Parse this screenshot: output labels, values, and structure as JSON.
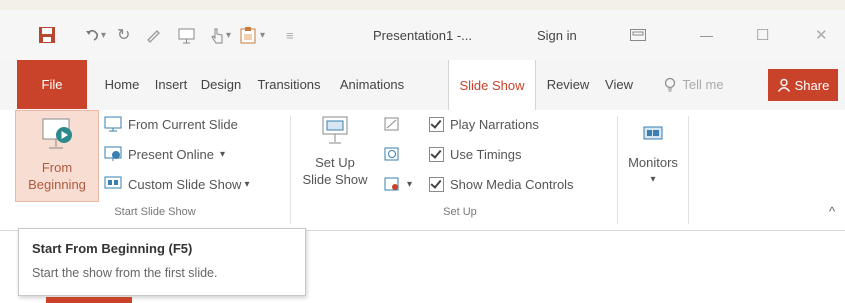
{
  "titlebar": {
    "doc_title": "Presentation1 -...",
    "sign_in": "Sign in",
    "min_glyph": "—",
    "max_glyph": "☐",
    "close_glyph": "✕",
    "undo_dropdown": "▾",
    "redo_glyph": "↻",
    "qat_dropdown": "▾",
    "qat_more": "▾"
  },
  "tabs": {
    "file": "File",
    "home": "Home",
    "insert": "Insert",
    "design": "Design",
    "transitions": "Transitions",
    "animations": "Animations",
    "slideshow": "Slide Show",
    "review": "Review",
    "view": "View",
    "tellme": "Tell me",
    "share": "Share"
  },
  "ribbon": {
    "start": {
      "from_beginning_line1": "From",
      "from_beginning_line2": "Beginning",
      "from_current": "From Current Slide",
      "present_online": "Present Online",
      "present_online_arrow": "▾",
      "custom_show": "Custom Slide Show",
      "custom_show_arrow": "▾",
      "group_label": "Start Slide Show"
    },
    "setup": {
      "setup_line1": "Set Up",
      "setup_line2": "Slide Show",
      "play_narrations": "Play Narrations",
      "use_timings": "Use Timings",
      "show_media_controls": "Show Media Controls",
      "small_dropdown": "▾",
      "group_label": "Set Up"
    },
    "monitors": {
      "label": "Monitors",
      "arrow": "▾"
    },
    "collapse_glyph": "^"
  },
  "tooltip": {
    "title": "Start From Beginning (F5)",
    "description": "Start the show from the first slide."
  },
  "colors": {
    "accent": "#c9432a",
    "ribbon_bg": "#ffffff",
    "tabs_bg": "#f5f5f5"
  }
}
